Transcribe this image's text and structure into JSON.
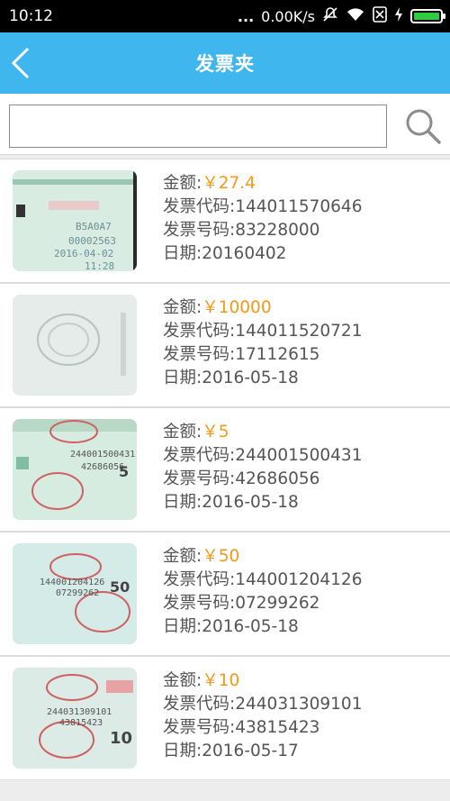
{
  "status_bar": {
    "time": "10:12",
    "dots": "...",
    "speed": "0.00K/s"
  },
  "nav": {
    "title": "发票夹"
  },
  "search": {
    "value": "",
    "placeholder": ""
  },
  "labels": {
    "amount": "金额:",
    "code": "发票代码:",
    "number": "发票号码:",
    "date": "日期:"
  },
  "invoices": [
    {
      "amount": "￥27.4",
      "code": "144011570646",
      "number": "83228000",
      "date": "20160402"
    },
    {
      "amount": "￥10000",
      "code": "144011520721",
      "number": "17112615",
      "date": "2016-05-18"
    },
    {
      "amount": "￥5",
      "code": "244001500431",
      "number": "42686056",
      "date": "2016-05-18"
    },
    {
      "amount": "￥50",
      "code": "144001204126",
      "number": "07299262",
      "date": "2016-05-18"
    },
    {
      "amount": "￥10",
      "code": "244031309101",
      "number": "43815423",
      "date": "2016-05-17"
    }
  ],
  "colors": {
    "nav": "#3fb7ee",
    "amount": "#f29a18",
    "text": "#555555"
  }
}
